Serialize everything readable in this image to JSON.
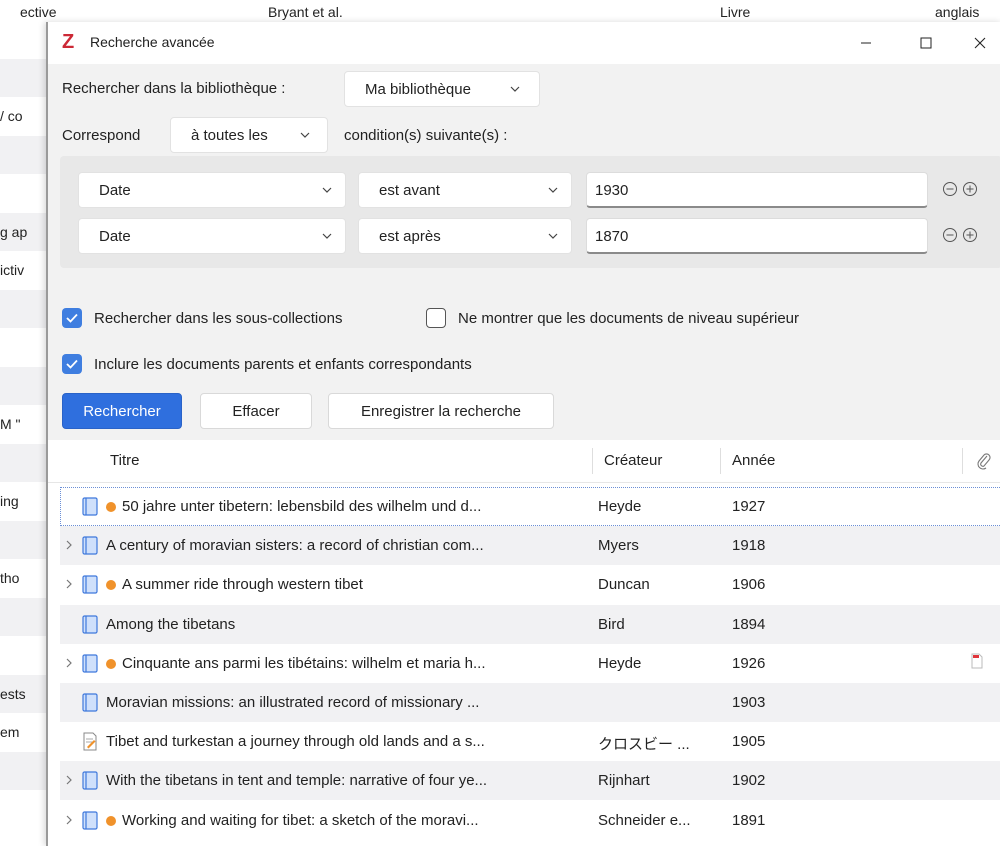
{
  "background": {
    "top_fragments": [
      "ective",
      "Bryant et al.",
      "Livre",
      "anglais"
    ],
    "side_fragments": [
      {
        "text": "/ co",
        "row": 2
      },
      {
        "text": "g ap",
        "row": 5
      },
      {
        "text": "ictiv",
        "row": 6
      },
      {
        "text": "M \"",
        "row": 10
      },
      {
        "text": "ing",
        "row": 12
      },
      {
        "text": "tho",
        "row": 14
      },
      {
        "text": "ests",
        "row": 17
      },
      {
        "text": "em",
        "row": 18
      }
    ]
  },
  "window": {
    "title": "Recherche avancée",
    "logo": "Z",
    "controls": [
      "minimize-icon",
      "maximize-icon",
      "close-icon"
    ]
  },
  "search": {
    "library_label": "Rechercher dans la bibliothèque :",
    "library_value": "Ma bibliothèque",
    "match_label": "Correspond",
    "match_value": "à toutes les",
    "match_suffix": "condition(s) suivante(s) :",
    "conditions": [
      {
        "field": "Date",
        "operator": "est avant",
        "value": "1930"
      },
      {
        "field": "Date",
        "operator": "est après",
        "value": "1870"
      }
    ],
    "options": [
      {
        "label": "Rechercher dans les sous-collections",
        "checked": true
      },
      {
        "label": "Ne montrer que les documents de niveau supérieur",
        "checked": false
      },
      {
        "label": "Inclure les documents parents et enfants correspondants",
        "checked": true
      }
    ],
    "buttons": {
      "search": "Rechercher",
      "clear": "Effacer",
      "save": "Enregistrer la recherche"
    }
  },
  "results": {
    "columns": {
      "title": "Titre",
      "creator": "Créateur",
      "year": "Année",
      "attachment": "paperclip-icon"
    },
    "rows": [
      {
        "title": "50 jahre unter tibetern: lebensbild des wilhelm und d...",
        "creator": "Heyde",
        "year": "1927",
        "twisty": false,
        "dot": true,
        "type": "book",
        "attachment": false,
        "selected": true
      },
      {
        "title": "A century of moravian sisters: a record of christian com...",
        "creator": "Myers",
        "year": "1918",
        "twisty": true,
        "dot": false,
        "type": "book",
        "attachment": false,
        "selected": false
      },
      {
        "title": "A summer ride through western tibet",
        "creator": "Duncan",
        "year": "1906",
        "twisty": true,
        "dot": true,
        "type": "book",
        "attachment": false,
        "selected": false
      },
      {
        "title": "Among the tibetans",
        "creator": "Bird",
        "year": "1894",
        "twisty": false,
        "dot": false,
        "type": "book",
        "attachment": false,
        "selected": false
      },
      {
        "title": "Cinquante ans parmi les tibétains: wilhelm et maria h...",
        "creator": "Heyde",
        "year": "1926",
        "twisty": true,
        "dot": true,
        "type": "book",
        "attachment": true,
        "selected": false
      },
      {
        "title": "Moravian missions: an illustrated record of missionary ...",
        "creator": "",
        "year": "1903",
        "twisty": false,
        "dot": false,
        "type": "book",
        "attachment": false,
        "selected": false
      },
      {
        "title": "Tibet and turkestan a journey through old lands and a s...",
        "creator": "クロスビー ...",
        "year": "1905",
        "twisty": false,
        "dot": false,
        "type": "document",
        "attachment": false,
        "selected": false
      },
      {
        "title": "With the tibetans in tent and temple: narrative of four ye...",
        "creator": "Rijnhart",
        "year": "1902",
        "twisty": true,
        "dot": false,
        "type": "book",
        "attachment": false,
        "selected": false
      },
      {
        "title": "Working and waiting for tibet: a sketch of the moravi...",
        "creator": "Schneider e...",
        "year": "1891",
        "twisty": true,
        "dot": true,
        "type": "book",
        "attachment": false,
        "selected": false
      }
    ]
  },
  "colors": {
    "accent": "#2f6fde",
    "dot": "#f0922b",
    "logo": "#cc2936",
    "alt_row": "#f1f1f3"
  }
}
